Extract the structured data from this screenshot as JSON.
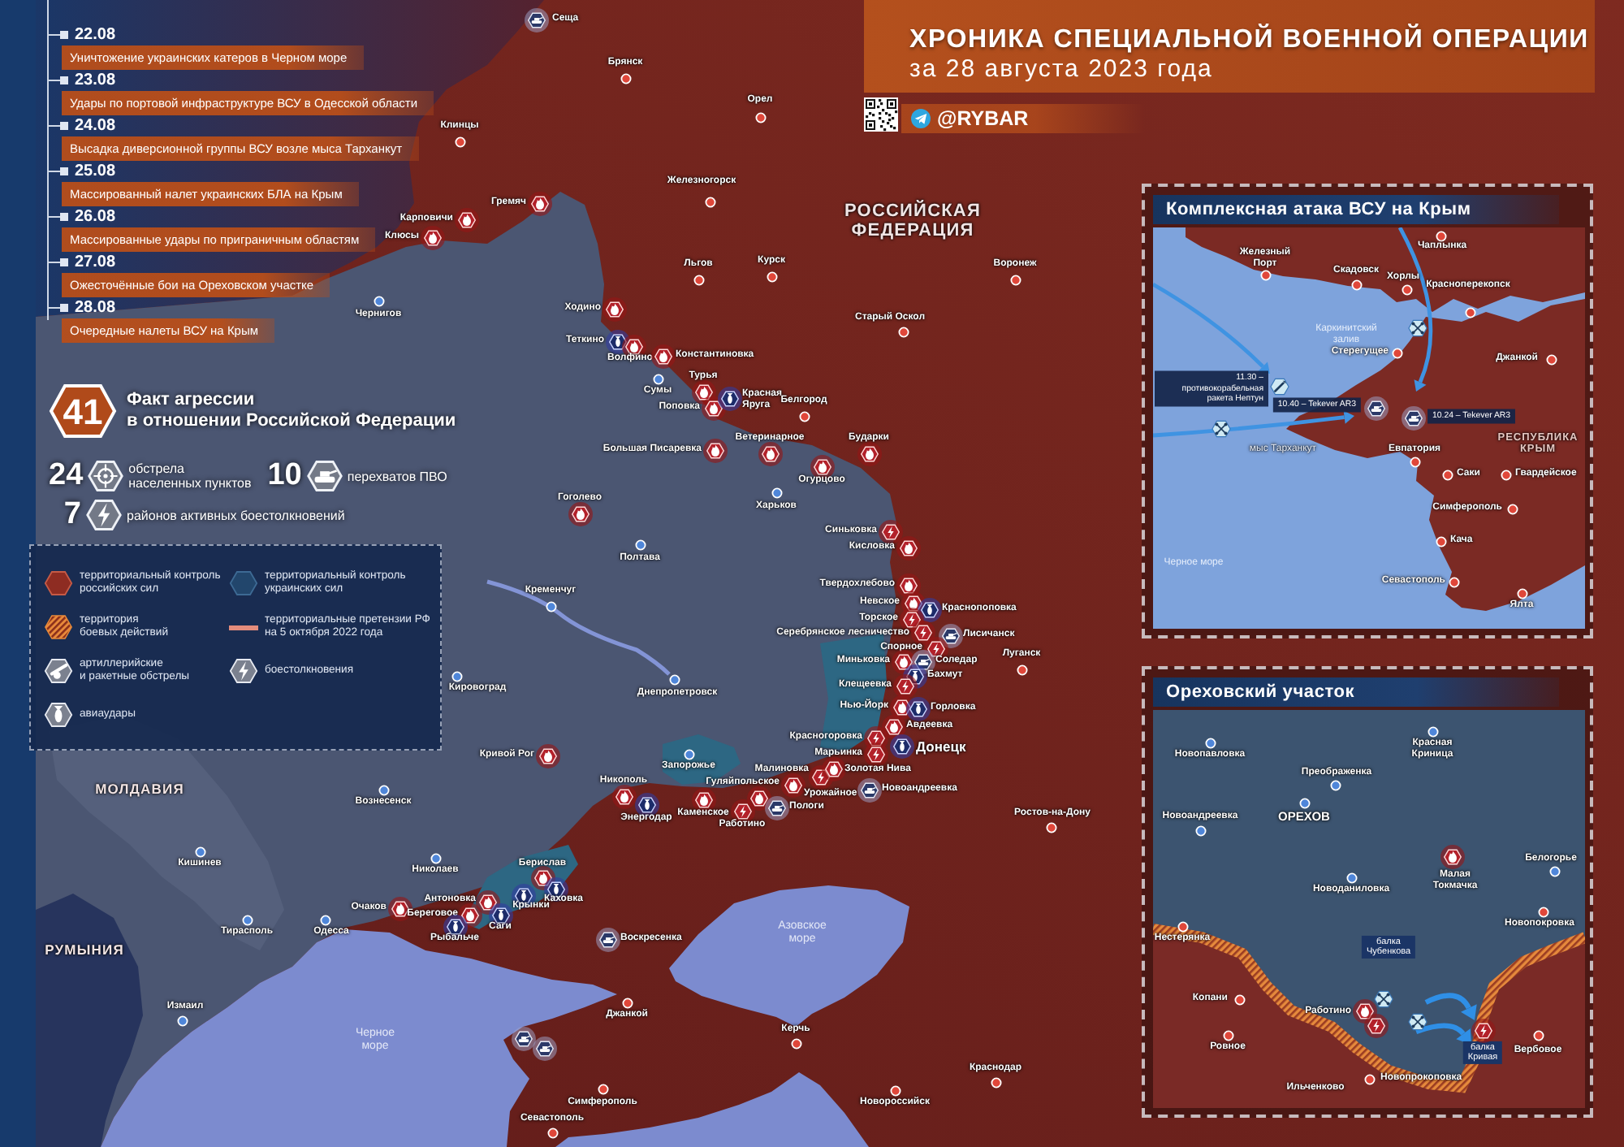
{
  "header": {
    "title": "ХРОНИКА СПЕЦИАЛЬНОЙ ВОЕННОЙ ОПЕРАЦИИ",
    "subtitle": "за 28 августа 2023 года",
    "handle": "@RYBAR"
  },
  "timeline": [
    {
      "date": "22.08",
      "text": "Уничтожение украинских катеров в Черном море"
    },
    {
      "date": "23.08",
      "text": "Удары по портовой инфраструктуре ВСУ в Одесской области"
    },
    {
      "date": "24.08",
      "text": "Высадка диверсионной группы ВСУ возле мыса Тарханкут"
    },
    {
      "date": "25.08",
      "text": "Массированный налет украинских БЛА на Крым"
    },
    {
      "date": "26.08",
      "text": "Массированные удары по приграничным областям"
    },
    {
      "date": "27.08",
      "text": "Ожесточённые бои на Ореховском участке"
    },
    {
      "date": "28.08",
      "text": "Очередные налеты ВСУ на Крым"
    }
  ],
  "summary": {
    "count": "41",
    "label": "Факт агрессии\nв отношении Российской Федерации",
    "stats": [
      {
        "kind": "shelling",
        "count": "24",
        "label": "обстрела\nнаселенных пунктов"
      },
      {
        "kind": "interception",
        "count": "10",
        "label": "перехватов ПВО"
      },
      {
        "kind": "clash",
        "count": "7",
        "label": "районов активных боестолкновений"
      }
    ]
  },
  "legend": [
    {
      "kind": "russian",
      "label": "территориальный контроль\nроссийских сил"
    },
    {
      "kind": "ukrainian",
      "label": "территориальный контроль\nукраинских сил"
    },
    {
      "kind": "combat",
      "label": "территория\nбоевых действий"
    },
    {
      "kind": "claims",
      "label": "территориальные претензии РФ\nна 5 октября 2022 года"
    },
    {
      "kind": "shelling",
      "label": "артиллерийские\nи ракетные обстрелы"
    },
    {
      "kind": "clash",
      "label": "боестолкновения"
    },
    {
      "kind": "airstrike",
      "label": "авиаудары"
    }
  ],
  "map": {
    "country_labels": [
      "РОССИЙСКАЯ\nФЕДЕРАЦИЯ",
      "МОЛДАВИЯ",
      "РУМЫНИЯ"
    ],
    "sea_labels": [
      "Азовское\nморе",
      "Черное\nморе"
    ],
    "places": [
      {
        "name": "Сеща",
        "kind": "interception"
      },
      {
        "name": "Брянск",
        "kind": "town",
        "color": "#e0473a"
      },
      {
        "name": "Орел",
        "kind": "town",
        "color": "#e0473a"
      },
      {
        "name": "Клинцы",
        "kind": "town",
        "color": "#e0473a"
      },
      {
        "name": "Железногорск",
        "kind": "town",
        "color": "#e0473a"
      },
      {
        "name": "Карповичи",
        "kind": "shelling"
      },
      {
        "name": "Гремяч",
        "kind": "shelling"
      },
      {
        "name": "Клюсы",
        "kind": "shelling"
      },
      {
        "name": "Чернигов",
        "kind": "town",
        "color": "#4f86d9"
      },
      {
        "name": "Льгов",
        "kind": "town",
        "color": "#e0473a"
      },
      {
        "name": "Курск",
        "kind": "town",
        "color": "#e0473a"
      },
      {
        "name": "Воронеж",
        "kind": "town",
        "color": "#e0473a"
      },
      {
        "name": "Старый Оскол",
        "kind": "town",
        "color": "#e0473a"
      },
      {
        "name": "Ходино",
        "kind": "shelling"
      },
      {
        "name": "Теткино",
        "kind": "airstrike"
      },
      {
        "name": "Волфино",
        "kind": "shelling"
      },
      {
        "name": "Константиновка",
        "kind": "shelling"
      },
      {
        "name": "Сумы",
        "kind": "town",
        "color": "#4f86d9"
      },
      {
        "name": "Турья",
        "kind": "shelling"
      },
      {
        "name": "Поповка",
        "kind": "shelling"
      },
      {
        "name": "Красная\nЯруга",
        "kind": "airstrike"
      },
      {
        "name": "Белгород",
        "kind": "town",
        "color": "#e0473a"
      },
      {
        "name": "Большая Писаревка",
        "kind": "shelling"
      },
      {
        "name": "Ветеринарное",
        "kind": "shelling"
      },
      {
        "name": "Огурцово",
        "kind": "shelling"
      },
      {
        "name": "Бударки",
        "kind": "shelling"
      },
      {
        "name": "Харьков",
        "kind": "town",
        "color": "#4f86d9"
      },
      {
        "name": "Гоголево",
        "kind": "shelling"
      },
      {
        "name": "Полтава",
        "kind": "town",
        "color": "#4f86d9"
      },
      {
        "name": "Кременчуг",
        "kind": "town",
        "color": "#4f86d9"
      },
      {
        "name": "Синьковка",
        "kind": "clash"
      },
      {
        "name": "Кисловка",
        "kind": "shelling"
      },
      {
        "name": "Твердохлебово",
        "kind": "shelling"
      },
      {
        "name": "Невское",
        "kind": "shelling"
      },
      {
        "name": "Краснопоповка",
        "kind": "airstrike"
      },
      {
        "name": "Торское",
        "kind": "clash"
      },
      {
        "name": "Серебрянское лесничество",
        "kind": "clash"
      },
      {
        "name": "Лисичанск",
        "kind": "interception"
      },
      {
        "name": "Спорное",
        "kind": "clash"
      },
      {
        "name": "Миньковка",
        "kind": "shelling"
      },
      {
        "name": "Соледар",
        "kind": "interception"
      },
      {
        "name": "Бахмут",
        "kind": "airstrike"
      },
      {
        "name": "Клещеевка",
        "kind": "clash"
      },
      {
        "name": "Нью-Йорк",
        "kind": "shelling"
      },
      {
        "name": "Горловка",
        "kind": "airstrike"
      },
      {
        "name": "Авдеевка",
        "kind": "shelling"
      },
      {
        "name": "Красногоровка",
        "kind": "clash"
      },
      {
        "name": "Марьинка",
        "kind": "clash"
      },
      {
        "name": "Донецк",
        "kind": "airstrike"
      },
      {
        "name": "Луганск",
        "kind": "town",
        "color": "#e0473a"
      },
      {
        "name": "Запорожье",
        "kind": "town",
        "color": "#4f86d9"
      },
      {
        "name": "Малиновка",
        "kind": "clash"
      },
      {
        "name": "Гуляйпольское",
        "kind": "shelling"
      },
      {
        "name": "Урожайное",
        "kind": "shelling"
      },
      {
        "name": "Золотая Нива",
        "kind": "shelling"
      },
      {
        "name": "Новоандреевка",
        "kind": "interception"
      },
      {
        "name": "Никополь",
        "kind": "shelling"
      },
      {
        "name": "Энергодар",
        "kind": "airstrike"
      },
      {
        "name": "Каменское",
        "kind": "shelling"
      },
      {
        "name": "Работино",
        "kind": "clash"
      },
      {
        "name": "Пологи",
        "kind": "interception"
      },
      {
        "name": "Кривой Рог",
        "kind": "shelling"
      },
      {
        "name": "Кировоград",
        "kind": "town",
        "color": "#4f86d9"
      },
      {
        "name": "Днепропетровск",
        "kind": "town",
        "color": "#4f86d9"
      },
      {
        "name": "Вознесенск",
        "kind": "town",
        "color": "#4f86d9"
      },
      {
        "name": "Николаев",
        "kind": "town",
        "color": "#4f86d9"
      },
      {
        "name": "Одесса",
        "kind": "town",
        "color": "#4f86d9"
      },
      {
        "name": "Очаков",
        "kind": "shelling"
      },
      {
        "name": "Антоновка",
        "kind": "shelling"
      },
      {
        "name": "Береговое",
        "kind": "shelling"
      },
      {
        "name": "Рыбальче",
        "kind": "airstrike"
      },
      {
        "name": "Берислав",
        "kind": "shelling"
      },
      {
        "name": "Каховка",
        "kind": "airstrike"
      },
      {
        "name": "Крынки",
        "kind": "airstrike"
      },
      {
        "name": "Саги",
        "kind": "airstrike"
      },
      {
        "name": "Воскресенка",
        "kind": "interception"
      },
      {
        "name": "Джанкой",
        "kind": "town",
        "color": "#e0473a"
      },
      {
        "name": "Керчь",
        "kind": "town",
        "color": "#e0473a"
      },
      {
        "name": "Краснодар",
        "kind": "town",
        "color": "#e0473a"
      },
      {
        "name": "Симферополь",
        "kind": "town",
        "color": "#e0473a"
      },
      {
        "name": "Новороссийск",
        "kind": "town",
        "color": "#e0473a"
      },
      {
        "name": "Севастополь",
        "kind": "town",
        "color": "#e0473a"
      },
      {
        "name": "Ростов-на-Дону",
        "kind": "town",
        "color": "#e0473a"
      },
      {
        "name": "Кишинев",
        "kind": "town",
        "color": "#4f86d9"
      },
      {
        "name": "Тирасполь",
        "kind": "town",
        "color": "#4f86d9"
      },
      {
        "name": "Измаил",
        "kind": "town",
        "color": "#4f86d9"
      }
    ],
    "markers": [
      {
        "kind": "interception"
      },
      {
        "kind": "interception"
      }
    ]
  },
  "crimea_inset": {
    "title": "Комплексная атака ВСУ на Крым",
    "places": [
      {
        "name": "Железный\nПорт",
        "kind": "town",
        "color": "#e0473a"
      },
      {
        "name": "Скадовск",
        "kind": "town",
        "color": "#e0473a"
      },
      {
        "name": "Чаплынка",
        "kind": "town",
        "color": "#e0473a"
      },
      {
        "name": "Хорлы",
        "kind": "town",
        "color": "#e0473a"
      },
      {
        "name": "Красноперекопск",
        "kind": "town",
        "color": "#e0473a"
      },
      {
        "name": "Стерегущее",
        "kind": "town",
        "color": "#e0473a"
      },
      {
        "name": "Джанкой",
        "kind": "town",
        "color": "#e0473a"
      },
      {
        "name": "Евпатория",
        "kind": "town",
        "color": "#e0473a"
      },
      {
        "name": "Саки",
        "kind": "town",
        "color": "#e0473a"
      },
      {
        "name": "Гвардейское",
        "kind": "town",
        "color": "#e0473a"
      },
      {
        "name": "Симферополь",
        "kind": "town",
        "color": "#e0473a"
      },
      {
        "name": "Кача",
        "kind": "town",
        "color": "#e0473a"
      },
      {
        "name": "Севастополь",
        "kind": "town",
        "color": "#e0473a"
      },
      {
        "name": "Ялта",
        "kind": "town",
        "color": "#e0473a"
      }
    ],
    "areas": [
      {
        "name": "Каркинитский\nзалив",
        "kind": "sea"
      },
      {
        "name": "мыс Тарханкут",
        "kind": "cape"
      },
      {
        "name": "РЕСПУБЛИКА\nКРЫМ",
        "kind": "region"
      },
      {
        "name": "Черное море",
        "kind": "sea"
      }
    ],
    "callouts": [
      {
        "text": "11.30 – противокорабельная ракета Нептун",
        "kind": "missile"
      },
      {
        "text": "10.40 – Tekever AR3",
        "kind": "interception"
      },
      {
        "text": "10.24 – Tekever AR3",
        "kind": "interception"
      }
    ],
    "markers": [
      {
        "kind": "drone"
      },
      {
        "kind": "drone"
      }
    ]
  },
  "orekhov_inset": {
    "title": "Ореховский участок",
    "places": [
      {
        "name": "Новопавловка",
        "kind": "town",
        "color": "#4f86d9"
      },
      {
        "name": "Красная\nКриница",
        "kind": "town",
        "color": "#4f86d9"
      },
      {
        "name": "Преображенка",
        "kind": "town",
        "color": "#4f86d9"
      },
      {
        "name": "ОРЕХОВ",
        "kind": "town",
        "color": "#4f86d9"
      },
      {
        "name": "Новоандреевка",
        "kind": "town",
        "color": "#4f86d9"
      },
      {
        "name": "Малая\nТокмачка",
        "kind": "shelling"
      },
      {
        "name": "Белогорье",
        "kind": "town",
        "color": "#4f86d9"
      },
      {
        "name": "Новоданиловка",
        "kind": "town",
        "color": "#4f86d9"
      },
      {
        "name": "Новопокровка",
        "kind": "town",
        "color": "#e0473a"
      },
      {
        "name": "Нестерянка",
        "kind": "town",
        "color": "#e0473a"
      },
      {
        "name": "Копани",
        "kind": "town",
        "color": "#e0473a"
      },
      {
        "name": "Работино",
        "kind": "shelling"
      },
      {
        "name": "Ровное",
        "kind": "town",
        "color": "#e0473a"
      },
      {
        "name": "Вербовое",
        "kind": "town",
        "color": "#e0473a"
      },
      {
        "name": "Ильченково",
        "kind": "label"
      },
      {
        "name": "Новопрокоповка",
        "kind": "town",
        "color": "#e0473a"
      }
    ],
    "areas": [
      {
        "name": "балка\nЧубенкова",
        "kind": "gully"
      },
      {
        "name": "балка\nКривая",
        "kind": "gully"
      }
    ],
    "markers": [
      {
        "kind": "clash"
      },
      {
        "kind": "clash"
      },
      {
        "kind": "drone"
      },
      {
        "kind": "drone"
      }
    ]
  }
}
